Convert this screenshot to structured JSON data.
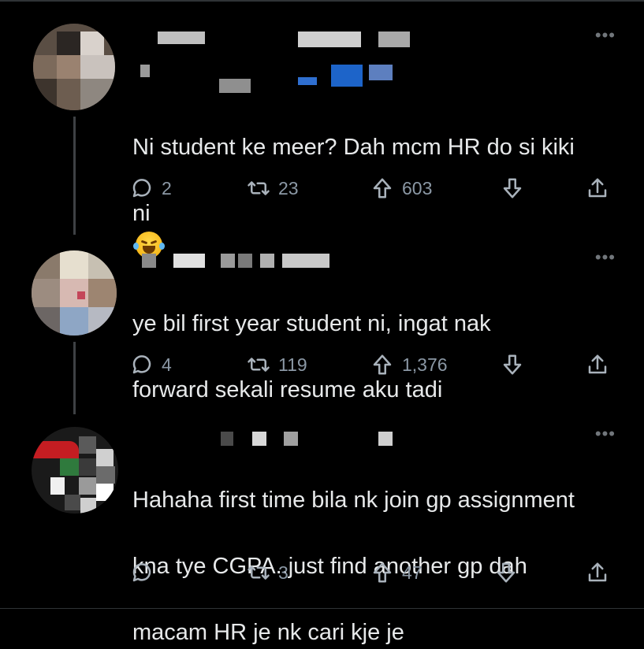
{
  "tweets": [
    {
      "text_line1": "Ni student ke meer? Dah mcm HR do si kiki",
      "text_line2": "ni",
      "replies": "2",
      "retweets": "23",
      "upvotes": "603",
      "more_label": "•••"
    },
    {
      "text_line1": "ye bil first year student ni, ingat nak",
      "text_line2": "forward sekali resume aku tadi",
      "replies": "4",
      "retweets": "119",
      "upvotes": "1,376",
      "more_label": "•••"
    },
    {
      "text_line1": "Hahaha first time bila nk join gp assignment",
      "text_line2": "kna tye CGPA..just find another gp dah",
      "text_line3": "macam HR je nk cari kje je",
      "replies": "",
      "retweets": "3",
      "upvotes": "47",
      "more_label": "•••"
    }
  ],
  "icons": {
    "reply": "reply-icon",
    "retweet": "retweet-icon",
    "upvote": "upvote-icon",
    "downvote": "downvote-icon",
    "share": "share-icon",
    "more": "more-icon",
    "emoji": "laughing-tears-emoji"
  },
  "colors": {
    "background": "#000000",
    "text": "#e7e9ea",
    "muted": "#71767b",
    "divider": "#2f3336"
  }
}
